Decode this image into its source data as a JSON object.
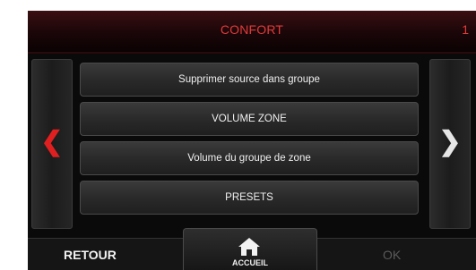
{
  "header": {
    "title": "CONFORT",
    "page_number": "1"
  },
  "nav": {
    "prev_icon": "chevron-left-icon",
    "next_icon": "chevron-right-icon",
    "prev_color": "#e02020",
    "next_color": "#e6e6e6"
  },
  "menu": {
    "items": [
      {
        "label": "Supprimer source dans groupe"
      },
      {
        "label": "VOLUME ZONE"
      },
      {
        "label": "Volume du groupe de zone"
      },
      {
        "label": "PRESETS"
      }
    ]
  },
  "footer": {
    "back_label": "RETOUR",
    "home_label": "ACCUEIL",
    "home_icon": "home-icon",
    "ok_label": "OK"
  },
  "colors": {
    "accent": "#e33a3a",
    "background": "#0a0a0a",
    "disabled": "#5a5a5a"
  }
}
